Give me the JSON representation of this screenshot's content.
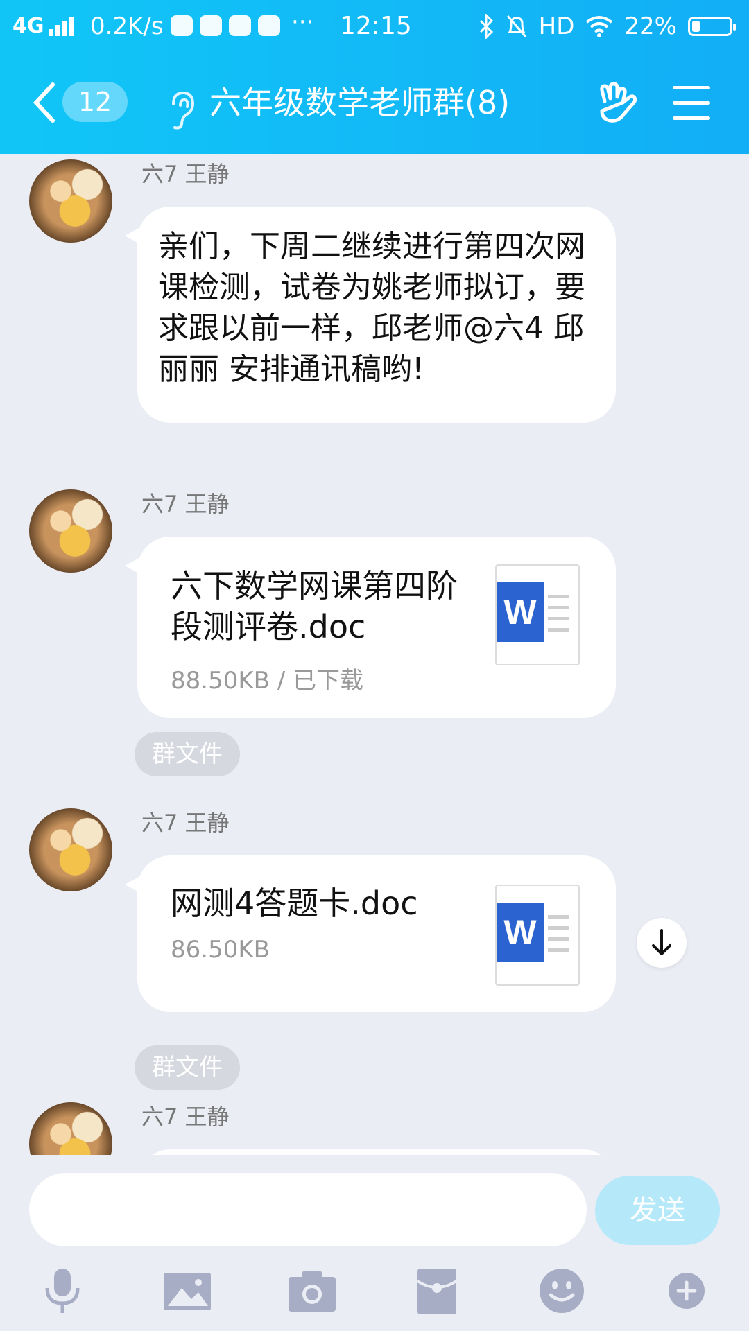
{
  "status_bar": {
    "network": "4G",
    "speed": "0.2K/s",
    "time": "12:15",
    "hd": "HD",
    "battery": "22%",
    "battery_level": 0.22,
    "icons": [
      "weibo-icon",
      "wechat-icon",
      "taobao-icon",
      "message-icon"
    ]
  },
  "header": {
    "back_badge": "12",
    "title": "六年级数学老师群(8)"
  },
  "messages": [
    {
      "sender": "六7 王静",
      "text": "亲们，下周二继续进行第四次网课检测，试卷为姚老师拟订，要求跟以前一样，邱老师@六4 邱丽丽 安排通讯稿哟!"
    },
    {
      "sender": "六7 王静",
      "file_name": "六下数学网课第四阶段测评卷.doc",
      "file_meta": "88.50KB / 已下载",
      "tag": "群文件"
    },
    {
      "sender": "六7 王静",
      "file_name": "网测4答题卡.doc",
      "file_meta": "86.50KB",
      "tag": "群文件"
    },
    {
      "sender": "六7 王静"
    }
  ],
  "doc_icon_letter": "W",
  "input": {
    "placeholder": "",
    "send_label": "发送"
  },
  "toolbar": [
    "microphone-icon",
    "image-icon",
    "camera-icon",
    "red-packet-icon",
    "emoji-icon",
    "plus-icon"
  ],
  "colors": {
    "header": "#12b8f6",
    "send_disabled": "#b5e9fa",
    "background": "#ebedf5",
    "word_blue": "#2b64d0"
  }
}
